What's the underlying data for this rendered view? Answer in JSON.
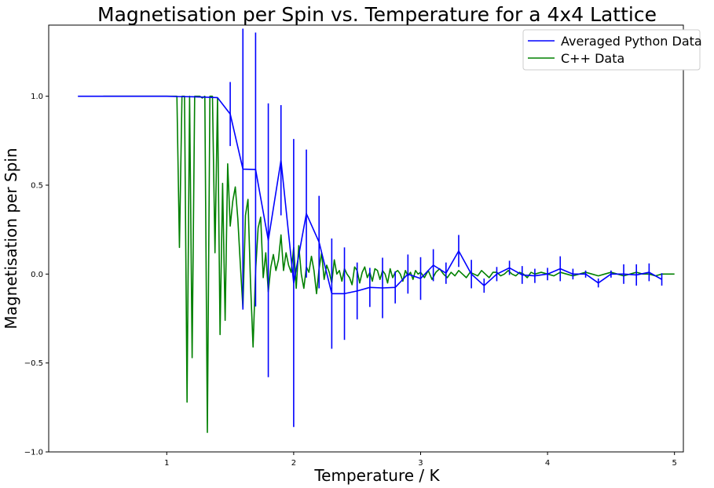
{
  "chart_data": {
    "type": "line",
    "title": "Magnetisation per Spin vs. Temperature for a 4x4 Lattice",
    "xlabel": "Temperature / K",
    "ylabel": "Magnetisation per Spin",
    "xlim": [
      0.07,
      5.07
    ],
    "ylim": [
      -1.0,
      1.4
    ],
    "xticks": [
      1,
      2,
      3,
      4,
      5
    ],
    "xtick_labels": [
      "1",
      "2",
      "3",
      "4",
      "5"
    ],
    "yticks": [
      -1.0,
      -0.5,
      0.0,
      0.5,
      1.0
    ],
    "ytick_labels": [
      "−1.0",
      "−0.5",
      "0.0",
      "0.5",
      "1.0"
    ],
    "grid": false,
    "legend_position": "top-right",
    "series": [
      {
        "name": "Averaged Python Data",
        "color": "#0000ff",
        "x": [
          0.3,
          0.4,
          0.5,
          0.6,
          0.7,
          0.8,
          0.9,
          1.0,
          1.1,
          1.2,
          1.3,
          1.4,
          1.5,
          1.6,
          1.7,
          1.8,
          1.9,
          2.0,
          2.1,
          2.2,
          2.3,
          2.4,
          2.5,
          2.6,
          2.7,
          2.8,
          2.9,
          3.0,
          3.1,
          3.2,
          3.3,
          3.4,
          3.5,
          3.6,
          3.7,
          3.8,
          3.9,
          4.0,
          4.1,
          4.2,
          4.3,
          4.4,
          4.5,
          4.6,
          4.7,
          4.8,
          4.9
        ],
        "y": [
          1.0,
          1.0,
          1.0,
          1.0,
          1.0,
          1.0,
          1.0,
          1.0,
          0.998,
          0.997,
          0.995,
          0.992,
          0.9,
          0.59,
          0.588,
          0.19,
          0.64,
          -0.05,
          0.34,
          0.18,
          -0.11,
          -0.11,
          -0.095,
          -0.075,
          -0.078,
          -0.075,
          0.0,
          -0.025,
          0.05,
          0.005,
          0.13,
          0.0,
          -0.065,
          0.0,
          0.035,
          -0.005,
          -0.01,
          0.0,
          0.03,
          0.0,
          0.0,
          -0.05,
          0.0,
          0.0,
          -0.005,
          0.01,
          -0.03
        ],
        "yerr": [
          0.0,
          0.0,
          0.0,
          0.0,
          0.0,
          0.0,
          0.0,
          0.0,
          0.0,
          0.0,
          0.0,
          0.0,
          0.18,
          0.79,
          0.77,
          0.77,
          0.31,
          0.81,
          0.36,
          0.26,
          0.31,
          0.26,
          0.16,
          0.11,
          0.17,
          0.09,
          0.11,
          0.12,
          0.09,
          0.06,
          0.09,
          0.08,
          0.04,
          0.04,
          0.04,
          0.05,
          0.04,
          0.035,
          0.07,
          0.03,
          0.02,
          0.025,
          0.02,
          0.055,
          0.06,
          0.05,
          0.035
        ]
      },
      {
        "name": "C++ Data",
        "color": "#008000",
        "x": [
          0.5,
          0.6,
          0.7,
          0.8,
          0.9,
          1.0,
          1.05,
          1.08,
          1.1,
          1.12,
          1.14,
          1.16,
          1.18,
          1.2,
          1.22,
          1.24,
          1.26,
          1.28,
          1.3,
          1.32,
          1.34,
          1.36,
          1.38,
          1.4,
          1.42,
          1.44,
          1.46,
          1.48,
          1.5,
          1.52,
          1.54,
          1.56,
          1.58,
          1.6,
          1.62,
          1.64,
          1.66,
          1.68,
          1.7,
          1.72,
          1.74,
          1.76,
          1.78,
          1.8,
          1.82,
          1.84,
          1.86,
          1.88,
          1.9,
          1.92,
          1.94,
          1.96,
          1.98,
          2.0,
          2.02,
          2.04,
          2.06,
          2.08,
          2.1,
          2.12,
          2.14,
          2.16,
          2.18,
          2.2,
          2.22,
          2.24,
          2.26,
          2.28,
          2.3,
          2.32,
          2.34,
          2.36,
          2.38,
          2.4,
          2.42,
          2.44,
          2.46,
          2.48,
          2.5,
          2.52,
          2.54,
          2.56,
          2.58,
          2.6,
          2.62,
          2.64,
          2.66,
          2.68,
          2.7,
          2.72,
          2.74,
          2.76,
          2.78,
          2.8,
          2.82,
          2.84,
          2.86,
          2.88,
          2.9,
          2.92,
          2.94,
          2.96,
          2.98,
          3.0,
          3.03,
          3.06,
          3.09,
          3.12,
          3.15,
          3.18,
          3.21,
          3.24,
          3.27,
          3.3,
          3.33,
          3.36,
          3.39,
          3.42,
          3.45,
          3.48,
          3.51,
          3.54,
          3.57,
          3.6,
          3.63,
          3.66,
          3.69,
          3.72,
          3.75,
          3.78,
          3.81,
          3.84,
          3.87,
          3.9,
          3.95,
          4.0,
          4.05,
          4.1,
          4.15,
          4.2,
          4.25,
          4.3,
          4.35,
          4.4,
          4.45,
          4.5,
          4.55,
          4.6,
          4.65,
          4.7,
          4.75,
          4.8,
          4.85,
          4.9,
          4.95,
          5.0
        ],
        "y": [
          1.0,
          1.0,
          1.0,
          1.0,
          1.0,
          1.0,
          1.0,
          1.0,
          0.15,
          1.0,
          1.0,
          -0.72,
          1.0,
          -0.47,
          1.0,
          1.0,
          1.0,
          0.99,
          1.0,
          -0.89,
          1.0,
          1.0,
          0.12,
          0.99,
          -0.34,
          0.51,
          -0.26,
          0.62,
          0.27,
          0.41,
          0.49,
          0.31,
          0.05,
          -0.19,
          0.33,
          0.42,
          -0.05,
          -0.41,
          0.02,
          0.26,
          0.32,
          -0.02,
          0.12,
          -0.1,
          0.04,
          0.11,
          0.02,
          0.08,
          0.22,
          0.02,
          0.12,
          0.05,
          0.01,
          0.15,
          -0.08,
          0.16,
          0.0,
          -0.08,
          0.04,
          0.01,
          0.1,
          0.02,
          -0.11,
          0.03,
          0.12,
          -0.03,
          0.05,
          0.01,
          -0.05,
          0.08,
          0.0,
          0.02,
          -0.04,
          0.03,
          0.0,
          -0.02,
          -0.06,
          0.04,
          0.02,
          -0.05,
          0.01,
          0.04,
          -0.02,
          0.01,
          -0.04,
          0.03,
          0.02,
          -0.03,
          0.02,
          0.0,
          -0.05,
          0.03,
          -0.02,
          0.01,
          0.02,
          0.0,
          -0.04,
          0.02,
          -0.01,
          0.01,
          -0.03,
          0.02,
          0.0,
          0.01,
          -0.02,
          0.02,
          -0.03,
          0.01,
          0.03,
          0.0,
          -0.02,
          0.01,
          -0.01,
          0.02,
          0.0,
          -0.02,
          0.01,
          0.0,
          -0.01,
          0.02,
          0.0,
          -0.02,
          0.01,
          0.01,
          -0.01,
          0.0,
          0.02,
          0.0,
          -0.01,
          0.01,
          0.0,
          -0.02,
          0.01,
          0.0,
          0.01,
          0.0,
          -0.01,
          0.01,
          0.0,
          -0.01,
          0.0,
          0.01,
          0.0,
          -0.01,
          0.0,
          0.01,
          0.0,
          -0.01,
          0.0,
          0.01,
          0.0,
          0.0,
          -0.01,
          0.0,
          0.0,
          0.0
        ]
      }
    ]
  }
}
